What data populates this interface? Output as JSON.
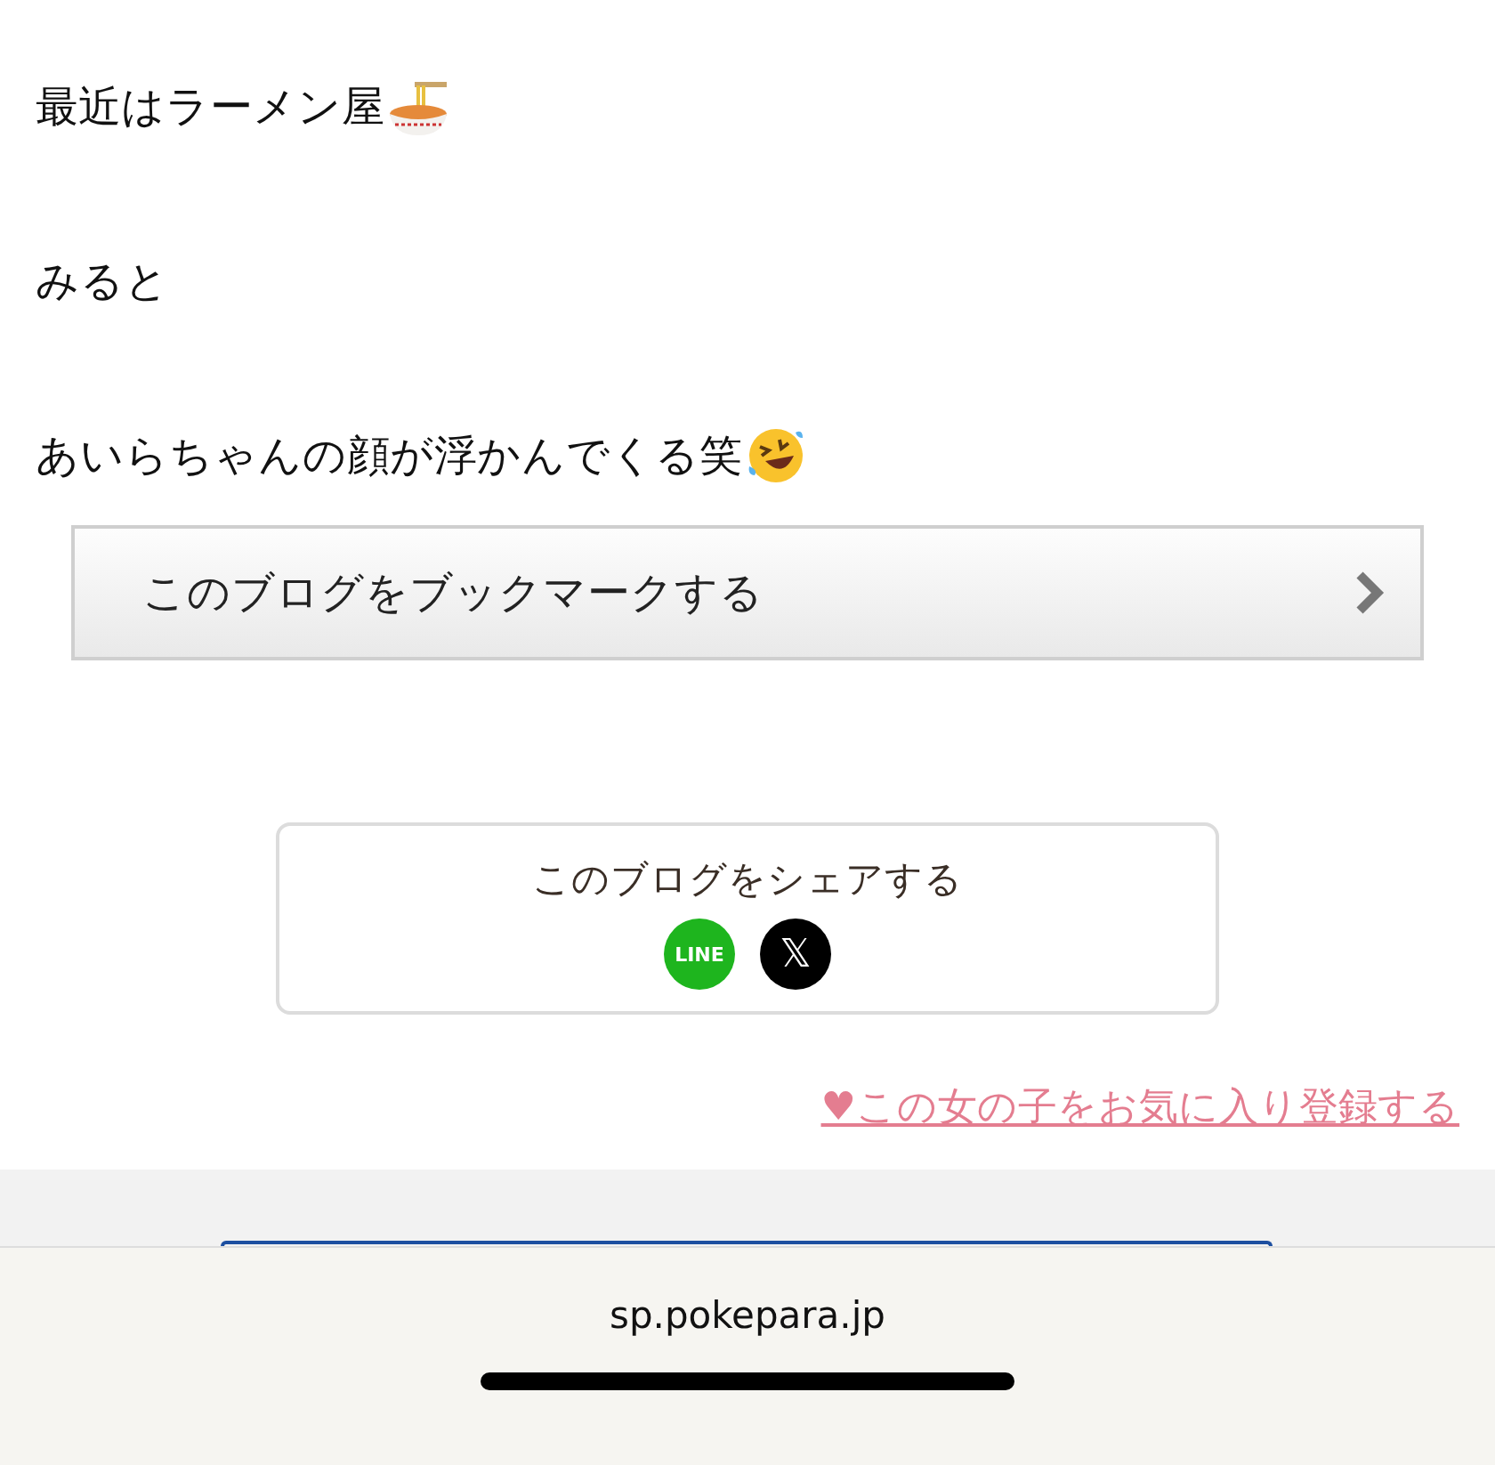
{
  "post": {
    "paragraphs": [
      {
        "kind": "ramen",
        "text": "最近はラーメン屋"
      },
      {
        "kind": "plain",
        "text": "みると"
      },
      {
        "kind": "laughing",
        "text": "あいらちゃんの顔が浮かんでくる笑"
      }
    ]
  },
  "bookmark_button": {
    "label": "このブログをブックマークする"
  },
  "share": {
    "title": "このブログをシェアする",
    "buttons": [
      {
        "kind": "line",
        "label": "LINE"
      },
      {
        "kind": "x",
        "label": "𝕏"
      }
    ]
  },
  "favorite_link": {
    "label": "♥この女の子をお気に入り登録する"
  },
  "browser_bar": {
    "url": "sp.pokepara.jp"
  }
}
